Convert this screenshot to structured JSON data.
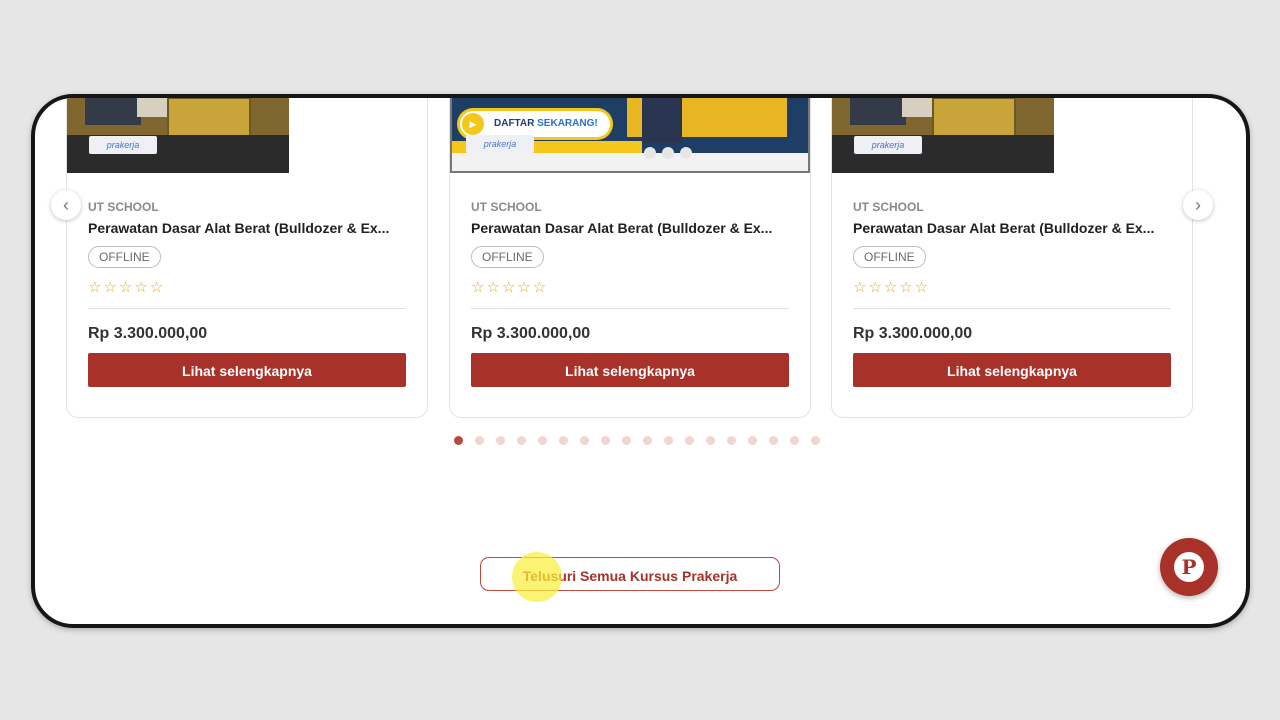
{
  "courses": [
    {
      "provider": "UT SCHOOL",
      "title": "Perawatan Dasar Alat Berat (Bulldozer & Ex...",
      "badge": "OFFLINE",
      "stars": "☆☆☆☆☆",
      "price": "Rp 3.300.000,00",
      "cta": "Lihat selengkapnya",
      "tag": "prakerja"
    },
    {
      "provider": "UT SCHOOL",
      "title": "Perawatan Dasar Alat Berat (Bulldozer & Ex...",
      "badge": "OFFLINE",
      "stars": "☆☆☆☆☆",
      "price": "Rp 3.300.000,00",
      "cta": "Lihat selengkapnya",
      "tag": "prakerja",
      "banner_play": "▶",
      "banner_text": "DAFTAR ",
      "banner_text_bold": "SEKARANG!"
    },
    {
      "provider": "UT SCHOOL",
      "title": "Perawatan Dasar Alat Berat (Bulldozer & Ex...",
      "badge": "OFFLINE",
      "stars": "☆☆☆☆☆",
      "price": "Rp 3.300.000,00",
      "cta": "Lihat selengkapnya",
      "tag": "prakerja"
    }
  ],
  "nav": {
    "prev_icon": "‹",
    "next_icon": "›"
  },
  "pagination": {
    "total": 18,
    "active": 1
  },
  "browse_button": "Telusuri Semua Kursus Prakerja",
  "fab": {
    "icon": "chat-p-icon",
    "letter": "P"
  },
  "colors": {
    "primary": "#a8312a",
    "star": "#e7a916"
  }
}
